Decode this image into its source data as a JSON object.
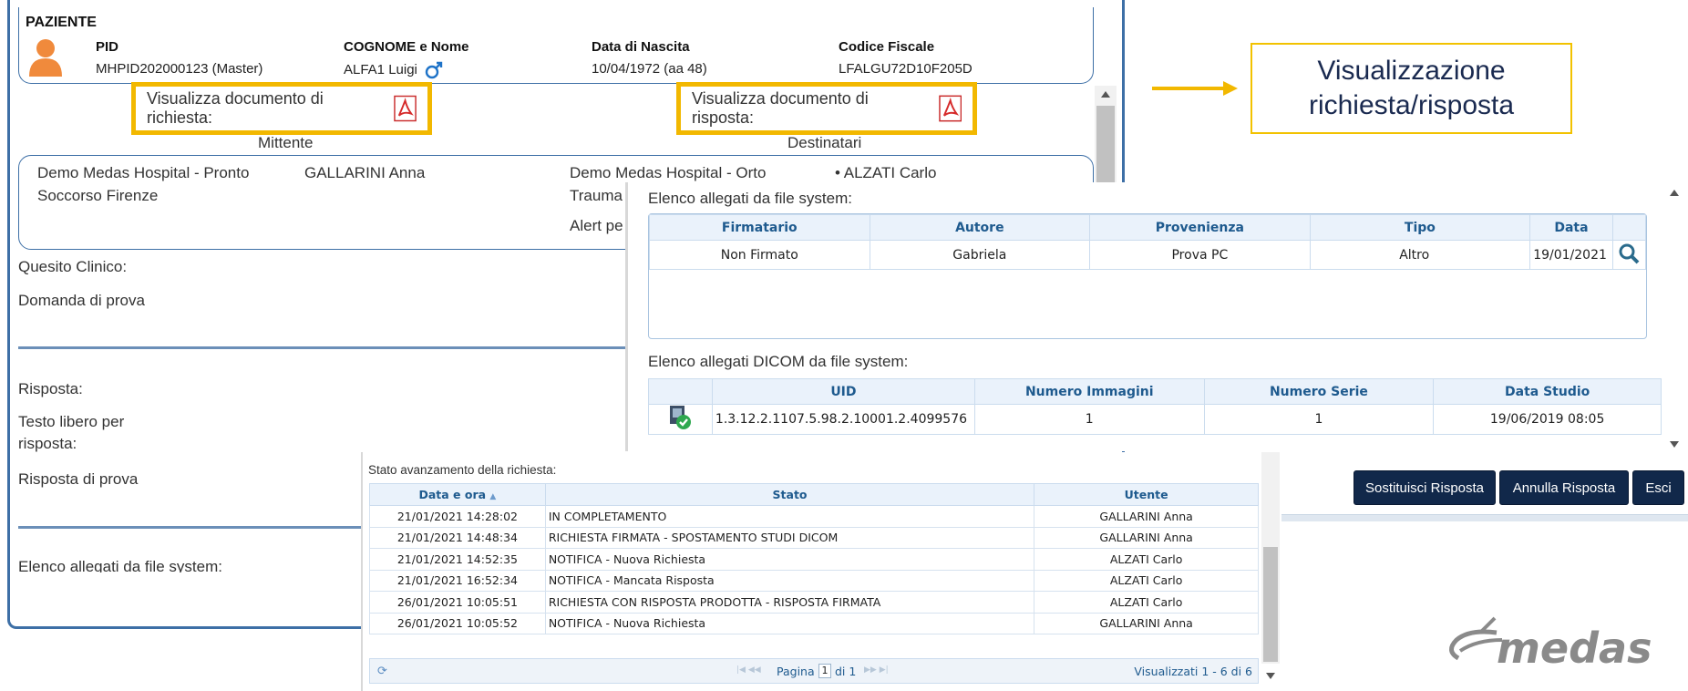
{
  "patient": {
    "section_title": "PAZIENTE",
    "cols": [
      {
        "header": "PID",
        "value": "MHPID202000123 (Master)"
      },
      {
        "header": "COGNOME e Nome",
        "value": "ALFA1 Luigi"
      },
      {
        "header": "Data di Nascita",
        "value": "10/04/1972 (aa 48)"
      },
      {
        "header": "Codice Fiscale",
        "value": "LFALGU72D10F205D"
      }
    ]
  },
  "documents": {
    "request_label": "Visualizza documento di richiesta:",
    "response_label": "Visualizza documento di risposta:"
  },
  "routing": {
    "sender_header": "Mittente",
    "recipients_header": "Destinatari",
    "sender_org": "Demo Medas Hospital - Pronto Soccorso Firenze",
    "sender_user": "GALLARINI Anna",
    "recipient_org_line1": "Demo Medas Hospital - Orto",
    "recipient_org_line2": "Trauma",
    "recipient_org_line3": "Alert pe",
    "recipient_user": "• ALZATI Carlo"
  },
  "request": {
    "clinical_question_label": "Quesito Clinico:",
    "clinical_question_value": "Domanda di prova",
    "response_label": "Risposta:",
    "free_text_label": "Testo libero per risposta:",
    "response_value": "Risposta di prova",
    "attachments_label_partial": "Elenco allegati da file system:"
  },
  "callout": {
    "text": "Visualizzazione richiesta/risposta",
    "accent": "#f2c200"
  },
  "attachments": {
    "fs_title": "Elenco allegati da file system:",
    "fs_columns": [
      "Firmatario",
      "Autore",
      "Provenienza",
      "Tipo",
      "Data"
    ],
    "fs_rows": [
      {
        "firmatario": "Non Firmato",
        "autore": "Gabriela",
        "provenienza": "Prova PC",
        "tipo": "Altro",
        "data": "19/01/2021"
      }
    ],
    "dicom_title": "Elenco allegati DICOM da file system:",
    "dicom_columns": [
      "UID",
      "Numero Immagini",
      "Numero Serie",
      "Data Studio"
    ],
    "dicom_rows": [
      {
        "uid": "1.3.12.2.1107.5.98.2.10001.2.4099576",
        "images": "1",
        "series": "1",
        "date": "19/06/2019 08:05"
      }
    ]
  },
  "actions": {
    "replace": "Sostituisci Risposta",
    "cancel": "Annulla Risposta",
    "exit": "Esci"
  },
  "status": {
    "title": "Stato avanzamento della richiesta:",
    "columns": [
      "Data e ora",
      "Stato",
      "Utente"
    ],
    "rows": [
      {
        "datetime": "21/01/2021 14:28:02",
        "state": "IN COMPLETAMENTO",
        "user": "GALLARINI Anna"
      },
      {
        "datetime": "21/01/2021 14:48:34",
        "state": "RICHIESTA FIRMATA - SPOSTAMENTO STUDI DICOM",
        "user": "GALLARINI Anna"
      },
      {
        "datetime": "21/01/2021 14:52:35",
        "state": "NOTIFICA - Nuova Richiesta",
        "user": "ALZATI Carlo"
      },
      {
        "datetime": "21/01/2021 16:52:34",
        "state": "NOTIFICA - Mancata Risposta",
        "user": "ALZATI Carlo"
      },
      {
        "datetime": "26/01/2021 10:05:51",
        "state": "RICHIESTA CON RISPOSTA PRODOTTA - RISPOSTA FIRMATA",
        "user": "ALZATI Carlo"
      },
      {
        "datetime": "26/01/2021 10:05:52",
        "state": "NOTIFICA - Nuova Richiesta",
        "user": "GALLARINI Anna"
      }
    ],
    "pager": {
      "page_label": "Pagina",
      "page_value": "1",
      "of_label": "di 1",
      "summary": "Visualizzati 1 - 6 di 6"
    }
  },
  "logo": {
    "text": "medas",
    "color": "#8a8a8a"
  },
  "colors": {
    "primary": "#11284a",
    "border": "#3d6fa6",
    "highlight": "#f2b800",
    "header_text": "#1e5a8e"
  }
}
